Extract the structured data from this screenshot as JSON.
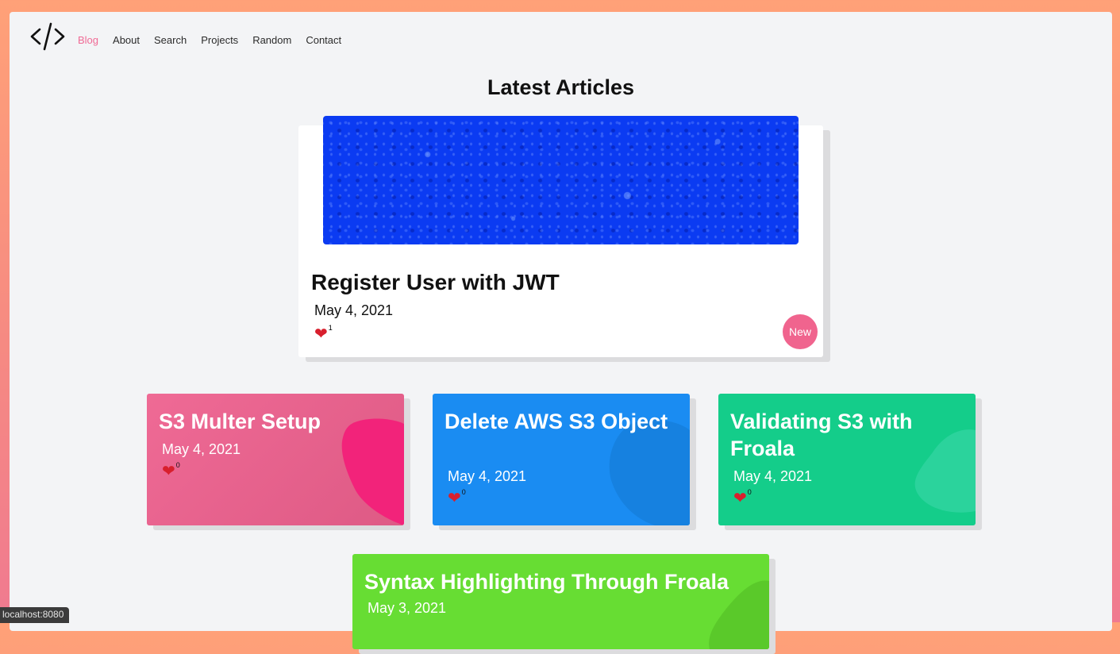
{
  "nav": {
    "logo_icon": "code-brackets-icon",
    "items": [
      {
        "label": "Blog",
        "active": true
      },
      {
        "label": "About"
      },
      {
        "label": "Search"
      },
      {
        "label": "Projects"
      },
      {
        "label": "Random"
      },
      {
        "label": "Contact"
      }
    ]
  },
  "heading": "Latest Articles",
  "featured": {
    "title": "Register User with JWT",
    "date": "May 4, 2021",
    "likes": "1",
    "badge": "New",
    "image": "blue-water-droplets"
  },
  "cards": [
    {
      "title": "S3 Multer Setup",
      "date": "May 4, 2021",
      "likes": "0",
      "color": "#ef6a95"
    },
    {
      "title": "Delete AWS S3 Object",
      "date": "May 4, 2021",
      "likes": "0",
      "color": "#1a8cf2"
    },
    {
      "title": "Validating S3 with Froala",
      "date": "May 4, 2021",
      "likes": "0",
      "color": "#14cd8a"
    },
    {
      "title": "Syntax Highlighting Through Froala",
      "date": "May 3, 2021",
      "color": "#67dd33"
    }
  ],
  "status_url": "localhost:8080",
  "colors": {
    "accent": "#f06a95",
    "heart": "#d81f2d"
  }
}
